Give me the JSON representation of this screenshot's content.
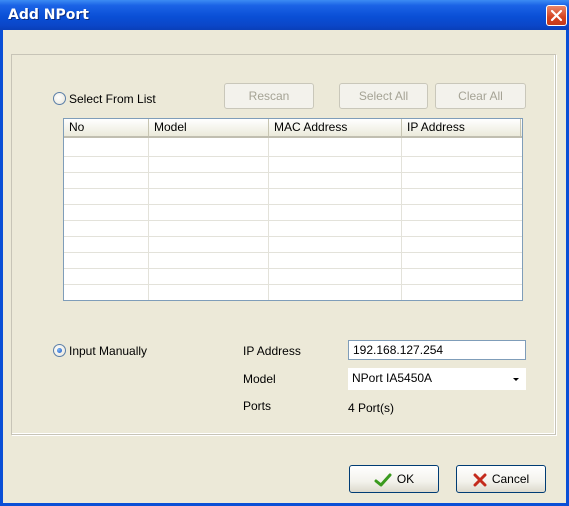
{
  "window": {
    "title": "Add NPort"
  },
  "select_from_list": {
    "label": "Select From List",
    "checked": false,
    "buttons": {
      "rescan": "Rescan",
      "select_all": "Select All",
      "clear_all": "Clear All"
    },
    "table": {
      "columns": [
        "No",
        "Model",
        "MAC Address",
        "IP Address"
      ],
      "rows": []
    }
  },
  "input_manually": {
    "label": "Input Manually",
    "checked": true,
    "ip_address": {
      "label": "IP Address",
      "value": "192.168.127.254"
    },
    "model": {
      "label": "Model",
      "value": "NPort IA5450A"
    },
    "ports": {
      "label": "Ports",
      "value": "4 Port(s)"
    }
  },
  "footer": {
    "ok_label": "OK",
    "cancel_label": "Cancel"
  },
  "colors": {
    "title_bar": "#0a4fd6",
    "dialog_bg": "#ece9d8",
    "close_red": "#d5431f",
    "ok_check": "#3a9a1f",
    "cancel_x": "#c42b1c"
  }
}
